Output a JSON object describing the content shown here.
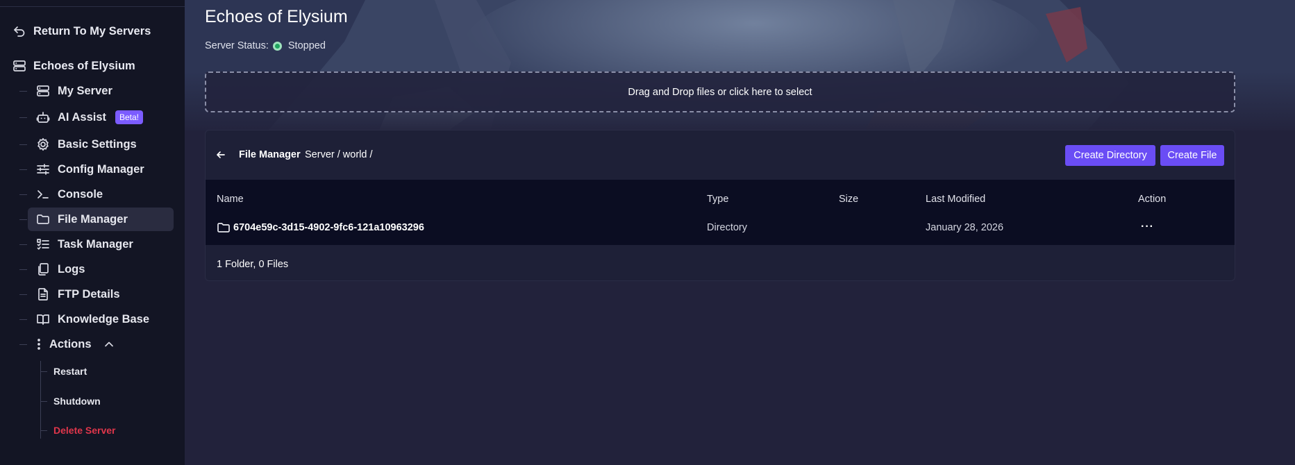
{
  "sidebar": {
    "return_label": "Return To My Servers",
    "server_name": "Echoes of Elysium",
    "items": [
      {
        "label": "My Server",
        "icon": "server-icon"
      },
      {
        "label": "AI Assist",
        "icon": "robot-icon",
        "badge": "Beta!"
      },
      {
        "label": "Basic Settings",
        "icon": "gear-icon"
      },
      {
        "label": "Config Manager",
        "icon": "sliders-icon"
      },
      {
        "label": "Console",
        "icon": "terminal-icon"
      },
      {
        "label": "File Manager",
        "icon": "folder-icon",
        "active": true
      },
      {
        "label": "Task Manager",
        "icon": "checklist-icon"
      },
      {
        "label": "Logs",
        "icon": "copy-icon"
      },
      {
        "label": "FTP Details",
        "icon": "document-icon"
      },
      {
        "label": "Knowledge Base",
        "icon": "book-icon"
      }
    ],
    "actions": {
      "label": "Actions",
      "sub_items": [
        "Restart",
        "Shutdown",
        "Delete Server"
      ]
    }
  },
  "header": {
    "title": "Echoes of Elysium",
    "status_label": "Server Status:",
    "status_value": "Stopped"
  },
  "dropzone": {
    "label": "Drag and Drop files or click here to select"
  },
  "file_manager": {
    "title": "File Manager",
    "path": "Server / world /",
    "create_directory_label": "Create Directory",
    "create_file_label": "Create File",
    "columns": [
      "Name",
      "Type",
      "Size",
      "Last Modified",
      "Action"
    ],
    "rows": [
      {
        "name": "6704e59c-3d15-4902-9fc6-121a10963296",
        "type": "Directory",
        "size": "",
        "last_modified": "January 28, 2026",
        "action": "···"
      }
    ],
    "footer": "1 Folder, 0 Files"
  },
  "colors": {
    "accent": "#6a4df5",
    "beta_badge": "#7b5cff",
    "danger": "#e0364b",
    "status_dot": "#1fa55f"
  }
}
